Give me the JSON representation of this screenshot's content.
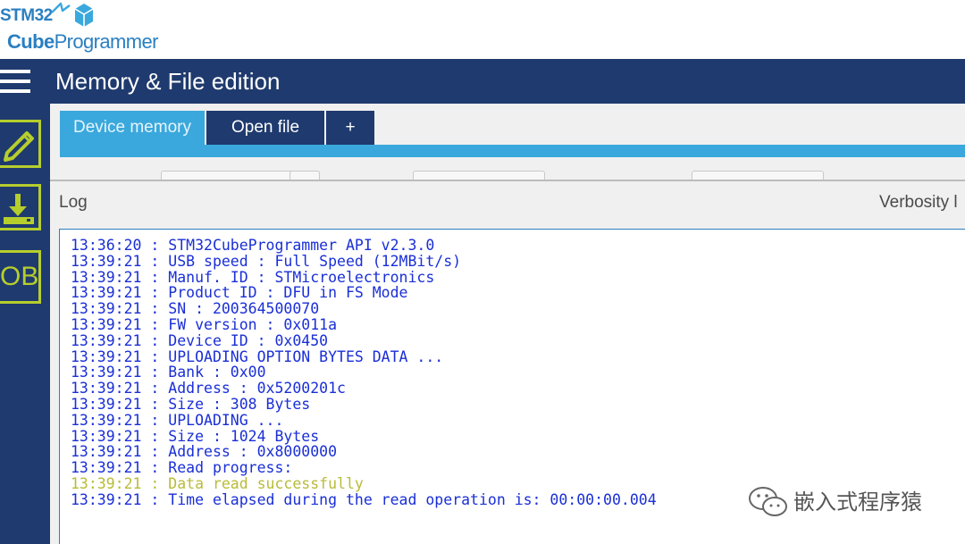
{
  "logo": {
    "line1": "STM32",
    "line2_bold": "Cube",
    "line2_light": "Programmer"
  },
  "header": {
    "title": "Memory & File edition"
  },
  "sidebar": {
    "items": [
      {
        "icon": "edit-memory-icon"
      },
      {
        "icon": "download-icon"
      },
      {
        "icon": "option-bytes-icon",
        "label": "OB"
      }
    ]
  },
  "tabs": [
    {
      "label": "Device memory",
      "active": true
    },
    {
      "label": "Open file",
      "active": false
    },
    {
      "label": "+",
      "active": false
    }
  ],
  "log_panel": {
    "label": "Log",
    "verbosity_label": "Verbosity l",
    "lines": [
      {
        "text": "13:36:20 : STM32CubeProgrammer API v2.3.0",
        "status": "info"
      },
      {
        "text": "13:39:21 : USB speed : Full Speed (12MBit/s)",
        "status": "info"
      },
      {
        "text": "13:39:21 : Manuf. ID : STMicroelectronics",
        "status": "info"
      },
      {
        "text": "13:39:21 : Product ID : DFU in FS Mode",
        "status": "info"
      },
      {
        "text": "13:39:21 : SN : 200364500070",
        "status": "info"
      },
      {
        "text": "13:39:21 : FW version : 0x011a",
        "status": "info"
      },
      {
        "text": "13:39:21 : Device ID : 0x0450",
        "status": "info"
      },
      {
        "text": "13:39:21 : UPLOADING OPTION BYTES DATA ...",
        "status": "info"
      },
      {
        "text": "13:39:21 : Bank : 0x00",
        "status": "info"
      },
      {
        "text": "13:39:21 : Address : 0x5200201c",
        "status": "info"
      },
      {
        "text": "13:39:21 : Size : 308 Bytes",
        "status": "info"
      },
      {
        "text": "13:39:21 : UPLOADING ...",
        "status": "info"
      },
      {
        "text": "13:39:21 : Size : 1024 Bytes",
        "status": "info"
      },
      {
        "text": "13:39:21 : Address : 0x8000000",
        "status": "info"
      },
      {
        "text": "13:39:21 : Read progress:",
        "status": "info"
      },
      {
        "text": "13:39:21 : Data read successfully",
        "status": "success"
      },
      {
        "text": "13:39:21 : Time elapsed during the read operation is: 00:00:00.004",
        "status": "info"
      }
    ]
  },
  "watermark": {
    "text": "嵌入式程序猿",
    "icon": "wechat-icon"
  },
  "colors": {
    "header_bg": "#1f3a6e",
    "tab_active": "#3aa8dc",
    "sidebar_accent": "#b6ce2c",
    "log_text": "#1a2fd6",
    "log_success": "#b8bb39"
  }
}
